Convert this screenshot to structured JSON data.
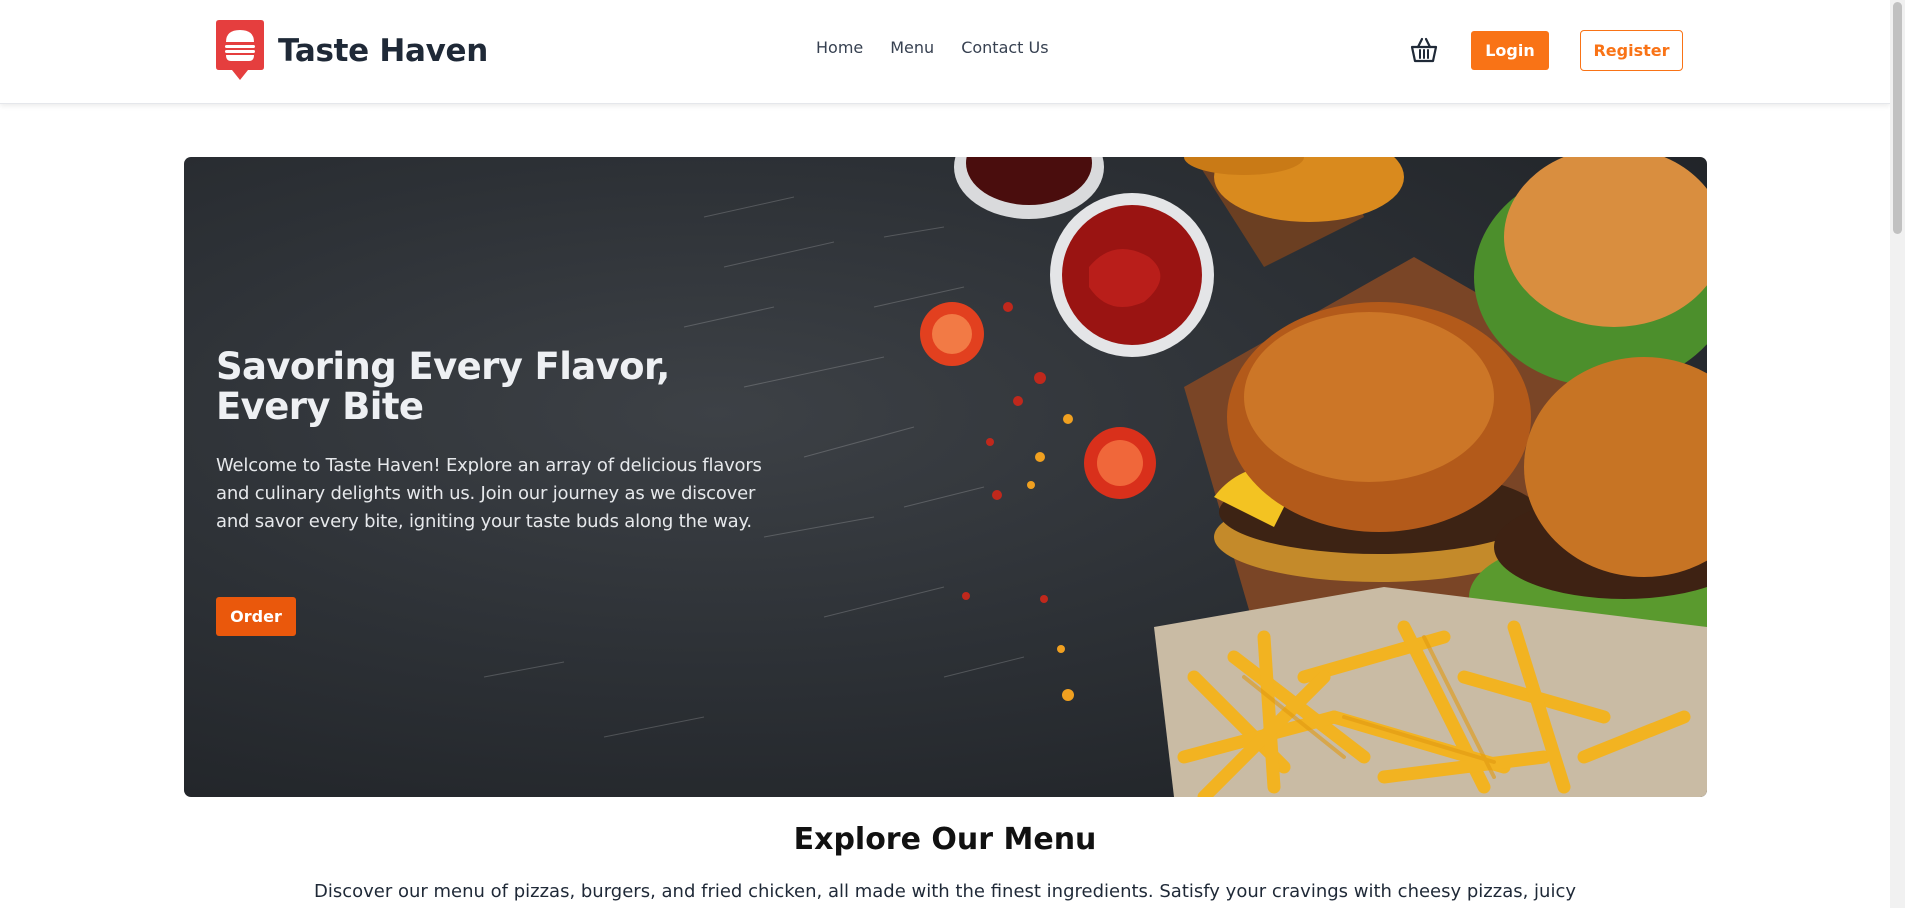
{
  "navbar": {
    "brand_name": "Taste Haven",
    "links": [
      {
        "label": "Home"
      },
      {
        "label": "Menu"
      },
      {
        "label": "Contact Us"
      }
    ],
    "cart_icon": "basket-icon",
    "login_label": "Login",
    "register_label": "Register"
  },
  "hero": {
    "title": "Savoring Every Flavor, Every Bite",
    "description": "Welcome to Taste Haven! Explore an array of delicious flavors and culinary delights with us. Join our journey as we discover and savor every bite, igniting your taste buds along the way.",
    "order_label": "Order",
    "image_subject": "burgers-fries-ketchup-photo"
  },
  "menu_section": {
    "title": "Explore Our Menu",
    "description": "Discover our menu of pizzas, burgers, and fried chicken, all made with the finest ingredients. Satisfy your cravings with cheesy pizzas, juicy"
  },
  "colors": {
    "accent": "#f97316",
    "accent_dark": "#ea580c",
    "logo_red": "#e53e3e",
    "text_dark": "#1f2937"
  }
}
